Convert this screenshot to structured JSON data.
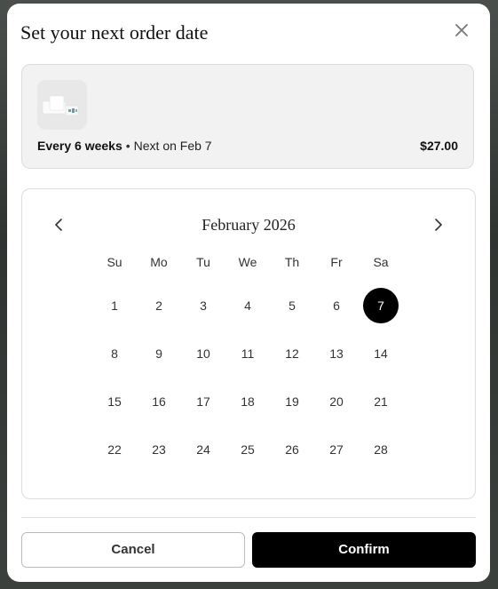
{
  "modal": {
    "title": "Set your next order date"
  },
  "product": {
    "frequency": "Every 6 weeks",
    "separator": "•",
    "next_text": "Next on Feb 7",
    "price": "$27.00"
  },
  "calendar": {
    "month_label": "February 2026",
    "weekdays": [
      "Su",
      "Mo",
      "Tu",
      "We",
      "Th",
      "Fr",
      "Sa"
    ],
    "days": [
      "1",
      "2",
      "3",
      "4",
      "5",
      "6",
      "7",
      "8",
      "9",
      "10",
      "11",
      "12",
      "13",
      "14",
      "15",
      "16",
      "17",
      "18",
      "19",
      "20",
      "21",
      "22",
      "23",
      "24",
      "25",
      "26",
      "27",
      "28"
    ],
    "selected_day": "7"
  },
  "actions": {
    "cancel_label": "Cancel",
    "confirm_label": "Confirm"
  },
  "icons": {
    "close": "close-icon",
    "prev": "chevron-left-icon",
    "next": "chevron-right-icon"
  },
  "colors": {
    "accent": "#000000",
    "card_bg": "#f2f2f2",
    "border": "#dddddd"
  }
}
